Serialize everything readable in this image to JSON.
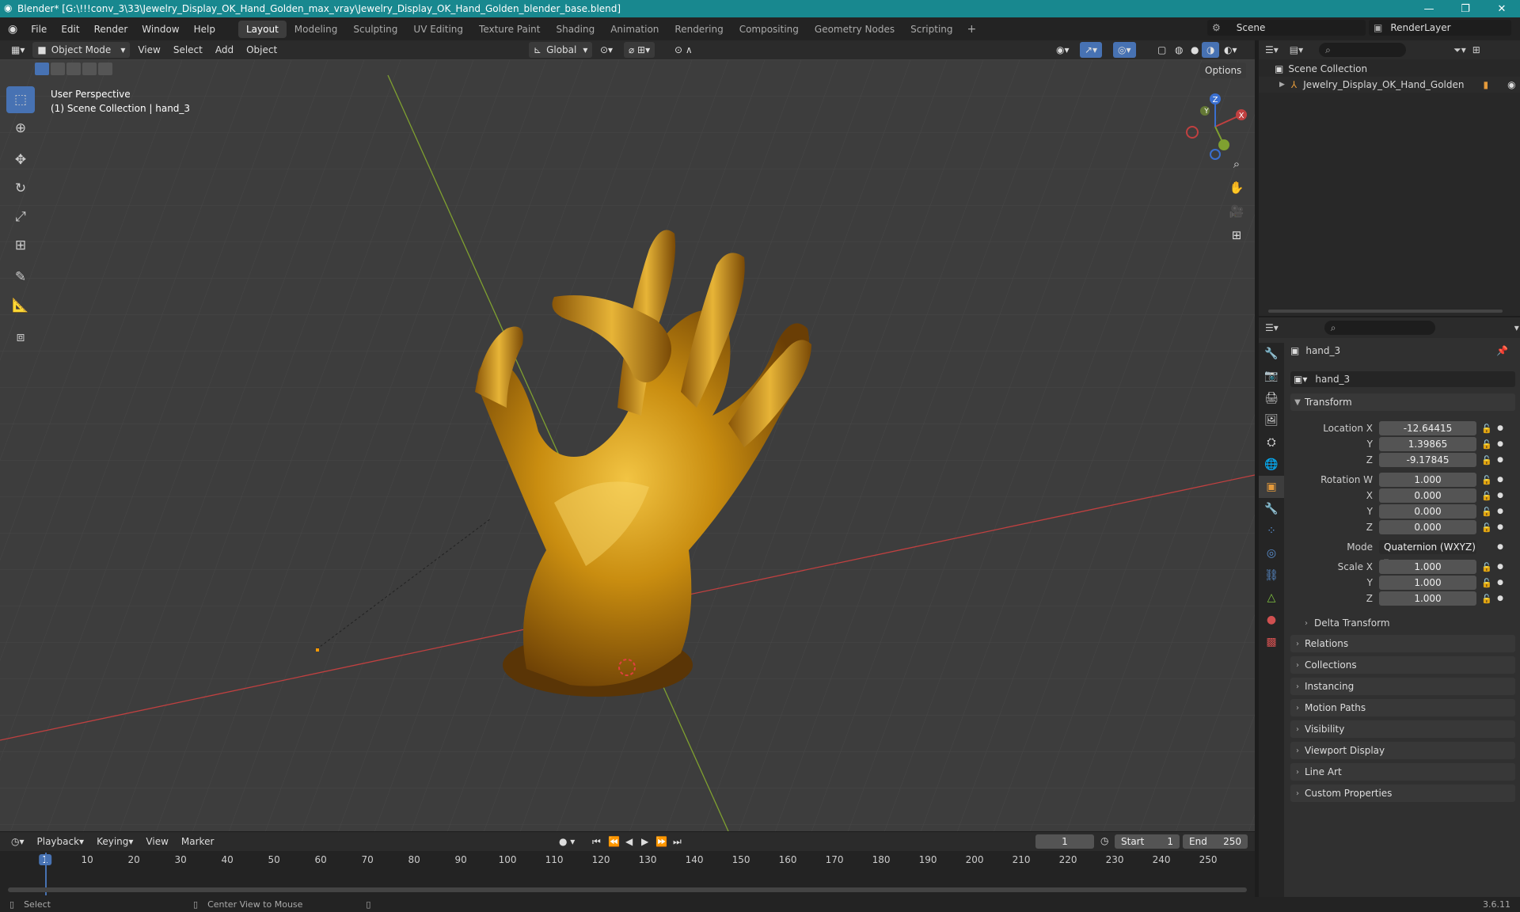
{
  "window": {
    "title": "Blender* [G:\\!!!conv_3\\33\\Jewelry_Display_OK_Hand_Golden_max_vray\\Jewelry_Display_OK_Hand_Golden_blender_base.blend]",
    "minimize": "—",
    "maximize": "❐",
    "close": "✕"
  },
  "menu": {
    "items": [
      "File",
      "Edit",
      "Render",
      "Window",
      "Help"
    ]
  },
  "workspaces": [
    "Layout",
    "Modeling",
    "Sculpting",
    "UV Editing",
    "Texture Paint",
    "Shading",
    "Animation",
    "Rendering",
    "Compositing",
    "Geometry Nodes",
    "Scripting"
  ],
  "scene": {
    "label": "Scene",
    "renderlayer": "RenderLayer"
  },
  "viewport_header": {
    "mode": "Object Mode",
    "view": "View",
    "select": "Select",
    "add": "Add",
    "object": "Object",
    "orientation": "Global",
    "options": "Options"
  },
  "viewport": {
    "perspective": "User Perspective",
    "collection_info": "(1) Scene Collection | hand_3"
  },
  "gizmo": {
    "x": "X",
    "y": "Y",
    "z": "Z"
  },
  "colors": {
    "x_axis": "#c04040",
    "y_axis": "#7fa030",
    "z_axis": "#3a6fd0",
    "accent": "#4772b3",
    "gold": "#c98d10"
  },
  "outliner": {
    "root": "Scene Collection",
    "item": "Jewelry_Display_OK_Hand_Golden"
  },
  "properties": {
    "object_name": "hand_3",
    "data_name": "hand_3",
    "transform_title": "Transform",
    "location": {
      "label": "Location X",
      "x": "-12.64415",
      "y": "1.39865",
      "z": "-9.17845"
    },
    "rotation": {
      "label": "Rotation W",
      "w": "1.000",
      "x": "0.000",
      "y": "0.000",
      "z": "0.000"
    },
    "mode": {
      "label": "Mode",
      "value": "Quaternion (WXYZ)"
    },
    "scale": {
      "label": "Scale X",
      "x": "1.000",
      "y": "1.000",
      "z": "1.000"
    },
    "axis_labels": {
      "x": "X",
      "y": "Y",
      "z": "Z"
    },
    "delta": "Delta Transform",
    "panels": [
      "Relations",
      "Collections",
      "Instancing",
      "Motion Paths",
      "Visibility",
      "Viewport Display",
      "Line Art",
      "Custom Properties"
    ]
  },
  "timeline": {
    "playback": "Playback",
    "keying": "Keying",
    "view": "View",
    "marker": "Marker",
    "current_frame": "1",
    "start_label": "Start",
    "start": "1",
    "end_label": "End",
    "end": "250",
    "ticks": [
      "1",
      "10",
      "20",
      "30",
      "40",
      "50",
      "60",
      "70",
      "80",
      "90",
      "100",
      "110",
      "120",
      "130",
      "140",
      "150",
      "160",
      "170",
      "180",
      "190",
      "200",
      "210",
      "220",
      "230",
      "240",
      "250"
    ]
  },
  "status": {
    "select": "Select",
    "center": "Center View to Mouse",
    "version": "3.6.11"
  }
}
